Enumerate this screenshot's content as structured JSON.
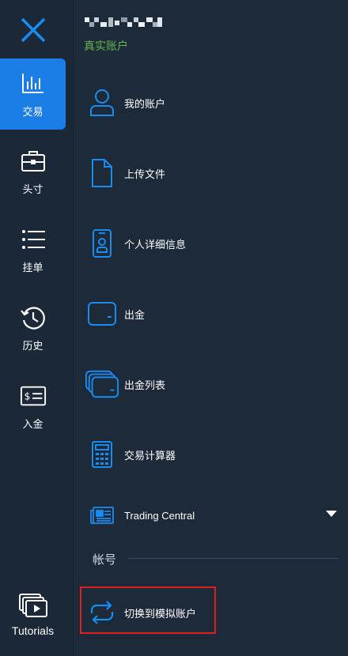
{
  "nav": {
    "items": [
      {
        "label": "交易",
        "icon": "chart-bars-icon",
        "active": true
      },
      {
        "label": "头寸",
        "icon": "briefcase-icon",
        "active": false
      },
      {
        "label": "挂单",
        "icon": "list-icon",
        "active": false
      },
      {
        "label": "历史",
        "icon": "history-icon",
        "active": false
      },
      {
        "label": "入金",
        "icon": "deposit-card-icon",
        "active": false
      }
    ],
    "tutorials_label": "Tutorials"
  },
  "account": {
    "type": "真实账户"
  },
  "menu": {
    "items": [
      {
        "label": "我的账户",
        "icon": "user-icon"
      },
      {
        "label": "上传文件",
        "icon": "file-icon"
      },
      {
        "label": "个人详细信息",
        "icon": "id-badge-icon"
      },
      {
        "label": "出金",
        "icon": "wallet-icon"
      },
      {
        "label": "出金列表",
        "icon": "wallets-stack-icon"
      },
      {
        "label": "交易计算器",
        "icon": "calculator-icon"
      },
      {
        "label": "Trading Central",
        "icon": "news-icon"
      }
    ],
    "section_label": "帐号",
    "switch_label": "切换到模拟账户"
  },
  "colors": {
    "accent": "#1a7ee6",
    "background": "#1b2838",
    "account_type": "#63b54c",
    "highlight": "#e02020"
  }
}
